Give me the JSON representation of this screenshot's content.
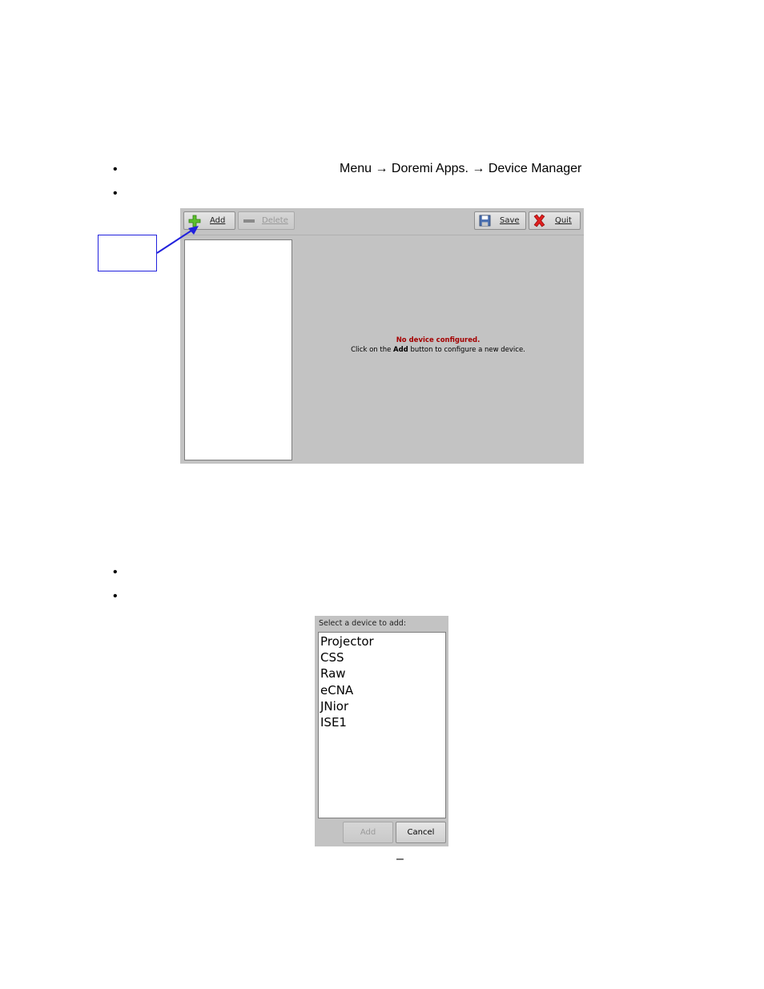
{
  "instructions": {
    "menu_path": "Menu → Doremi Apps. → Device Manager",
    "bullet_glyph": "•"
  },
  "device_manager": {
    "toolbar": {
      "add_label": "Add",
      "delete_label": "Delete",
      "save_label": "Save",
      "quit_label": "Quit"
    },
    "message_title": "No device configured.",
    "message_prefix": "Click on the ",
    "message_bold": "Add",
    "message_suffix": " button to configure a new device.",
    "icons": {
      "add": "plus-icon",
      "delete": "minus-icon",
      "save": "floppy-disk-icon",
      "quit": "red-x-icon"
    }
  },
  "add_dialog": {
    "title": "Select a device to add:",
    "devices": [
      "Projector",
      "CSS",
      "Raw",
      "eCNA",
      "JNior",
      "ISE1"
    ],
    "add_label": "Add",
    "cancel_label": "Cancel"
  },
  "footer_dash": "–",
  "colors": {
    "panel": "#c3c3c3",
    "callout": "#2222dd",
    "warning": "#a40000"
  }
}
